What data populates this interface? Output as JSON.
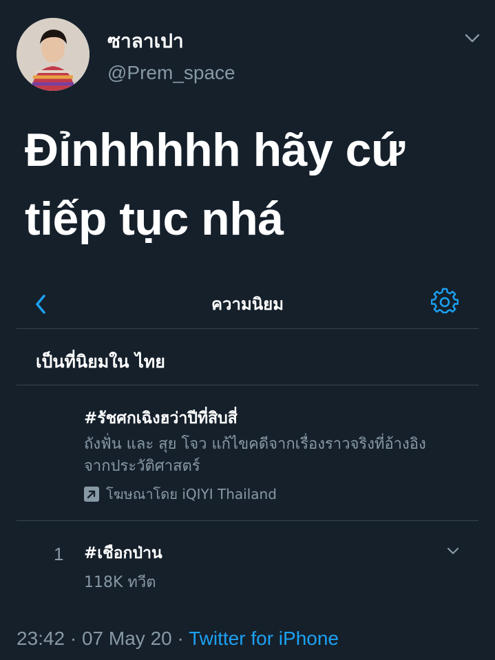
{
  "author": {
    "display_name": "ซาลาเปา",
    "handle": "@Prem_space"
  },
  "tweet": {
    "text_line1": "Đỉnhhhhh hãy cứ",
    "text_line2": "tiếp tục nhá"
  },
  "embedded_card": {
    "header_title": "ความนิยม",
    "section_title": "เป็นที่นิยมใน ไทย",
    "promoted": {
      "hashtag": "#รัชศกเฉิงฮว่าปีที่สิบสี่",
      "description": "ถังฟั่น และ สุย โจว แก้ไขคดีจากเรื่องราวจริงที่อ้างอิงจากประวัติศาสตร์",
      "sponsor_text": "โฆษณาโดย iQIYI Thailand"
    },
    "trend": {
      "rank": "1",
      "hashtag": "#เชือกป่าน",
      "tweet_count": "118K ทวีต"
    }
  },
  "meta": {
    "time": "23:42",
    "separator": " · ",
    "date": "07 May 20",
    "source": "Twitter for iPhone"
  },
  "icons": [
    "chevron-down-icon",
    "back-arrow-icon",
    "gear-icon",
    "promoted-arrow-icon"
  ],
  "colors": {
    "background": "#15202b",
    "secondary_text": "#8899a6",
    "accent": "#1da1f2",
    "divider": "#38444d"
  }
}
